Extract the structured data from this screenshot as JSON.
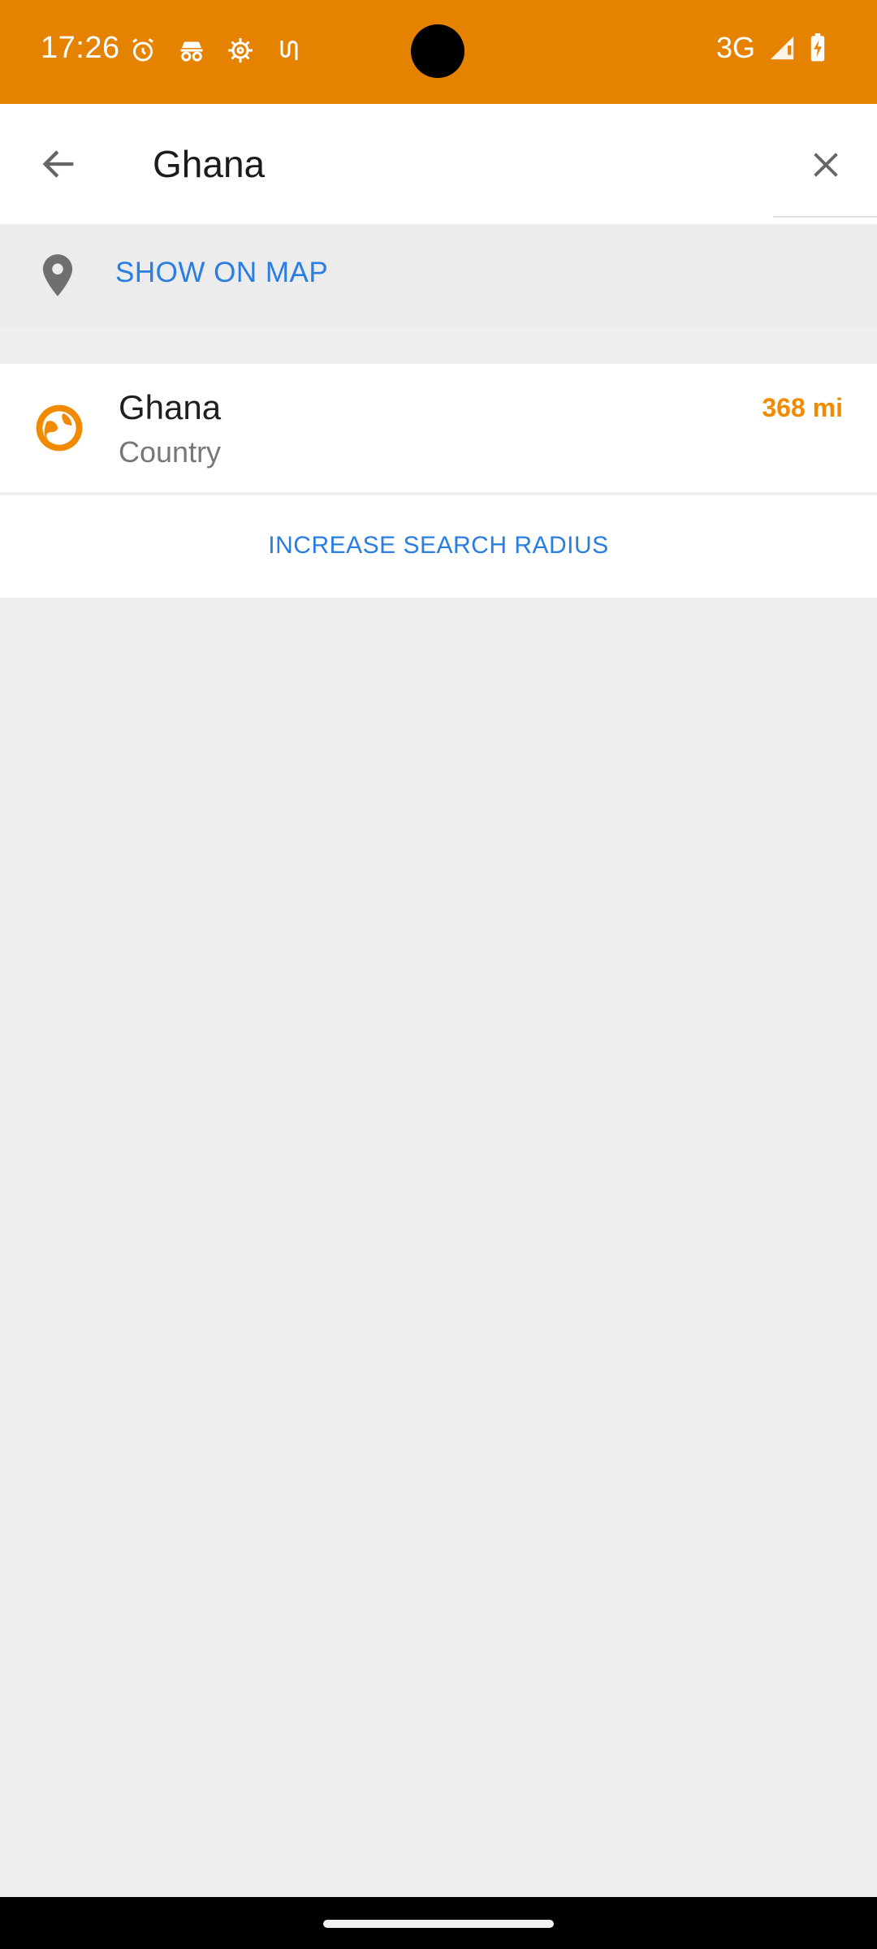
{
  "status_bar": {
    "time": "17:26",
    "network": "3G",
    "icons": [
      "alarm-icon",
      "incognito-icon",
      "settings-gear-icon",
      "vpn-key-icon",
      "signal-icon",
      "battery-charging-icon"
    ]
  },
  "search": {
    "value": "Ghana",
    "back_icon": "arrow-left-icon",
    "clear_icon": "close-icon"
  },
  "show_on_map": {
    "label": "SHOW ON MAP",
    "icon": "map-pin-icon"
  },
  "results": [
    {
      "name": "Ghana",
      "type": "Country",
      "distance": "368 mi",
      "icon": "globe-icon"
    }
  ],
  "actions": {
    "increase_radius": "INCREASE SEARCH RADIUS"
  },
  "colors": {
    "accent": "#e58200",
    "link_blue": "#2a7de1",
    "distance_orange": "#f08a00"
  }
}
